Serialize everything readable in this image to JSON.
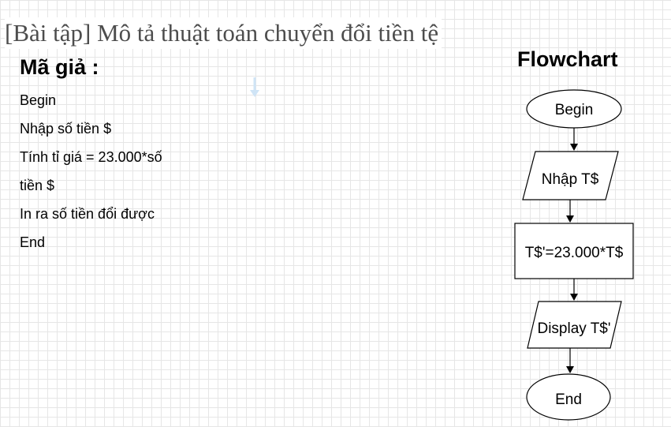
{
  "title": "[Bài tập] Mô tả thuật toán chuyển đổi tiền tệ",
  "pseudocode": {
    "heading": "Mã giả :",
    "lines": [
      " Begin",
      " Nhập số tiền $",
      "Tính tỉ giá = 23.000*số",
      "tiền $",
      "In ra số tiền đổi được",
      "End"
    ]
  },
  "flowchart": {
    "heading": "Flowchart",
    "nodes": [
      {
        "id": "begin",
        "shape": "ellipse",
        "label": "Begin"
      },
      {
        "id": "input",
        "shape": "parallelogram",
        "label": "Nhập T$"
      },
      {
        "id": "process",
        "shape": "rectangle",
        "label": "T$'=23.000*T$"
      },
      {
        "id": "display",
        "shape": "parallelogram",
        "label": "Display T$'"
      },
      {
        "id": "end",
        "shape": "ellipse",
        "label": "End"
      }
    ],
    "edges": [
      {
        "from": "begin",
        "to": "input"
      },
      {
        "from": "input",
        "to": "process"
      },
      {
        "from": "process",
        "to": "display"
      },
      {
        "from": "display",
        "to": "end"
      }
    ]
  },
  "colors": {
    "grid": "#e6e6e6",
    "title_text": "#4d4d4d",
    "stroke": "#000000",
    "faint_arrow": "#cfe4f6"
  }
}
